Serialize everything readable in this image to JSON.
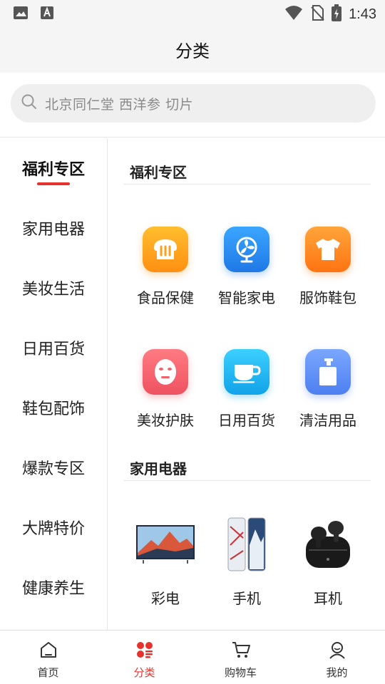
{
  "status_bar": {
    "time": "1:43"
  },
  "header": {
    "title": "分类"
  },
  "search": {
    "placeholder": "北京同仁堂 西洋参 切片"
  },
  "sidebar": {
    "items": [
      {
        "label": "福利专区",
        "active": true
      },
      {
        "label": "家用电器"
      },
      {
        "label": "美妆生活"
      },
      {
        "label": "日用百货"
      },
      {
        "label": "鞋包配饰"
      },
      {
        "label": "爆款专区"
      },
      {
        "label": "大牌特价"
      },
      {
        "label": "健康养生"
      }
    ]
  },
  "content": {
    "sections": [
      {
        "title": "福利专区",
        "items": [
          {
            "label": "食品保健",
            "icon": "bread-icon",
            "color": "#ff9f1a"
          },
          {
            "label": "智能家电",
            "icon": "fan-icon",
            "color": "#2f8ff0"
          },
          {
            "label": "服饰鞋包",
            "icon": "tshirt-icon",
            "color": "#ff8a1e"
          },
          {
            "label": "美妆护肤",
            "icon": "face-mask-icon",
            "color": "#f0646c"
          },
          {
            "label": "日用百货",
            "icon": "cup-icon",
            "color": "#1fb8ef"
          },
          {
            "label": "清洁用品",
            "icon": "soap-bottle-icon",
            "color": "#5b8ff4"
          }
        ]
      },
      {
        "title": "家用电器",
        "items": [
          {
            "label": "彩电",
            "icon": "tv-image"
          },
          {
            "label": "手机",
            "icon": "phone-image"
          },
          {
            "label": "耳机",
            "icon": "earbuds-image"
          }
        ]
      }
    ]
  },
  "tabbar": {
    "tabs": [
      {
        "label": "首页",
        "icon": "home-icon"
      },
      {
        "label": "分类",
        "icon": "category-icon",
        "active": true
      },
      {
        "label": "购物车",
        "icon": "cart-icon"
      },
      {
        "label": "我的",
        "icon": "user-icon"
      }
    ]
  },
  "colors": {
    "accent": "#e6322d",
    "background": "#f5f5f5"
  }
}
